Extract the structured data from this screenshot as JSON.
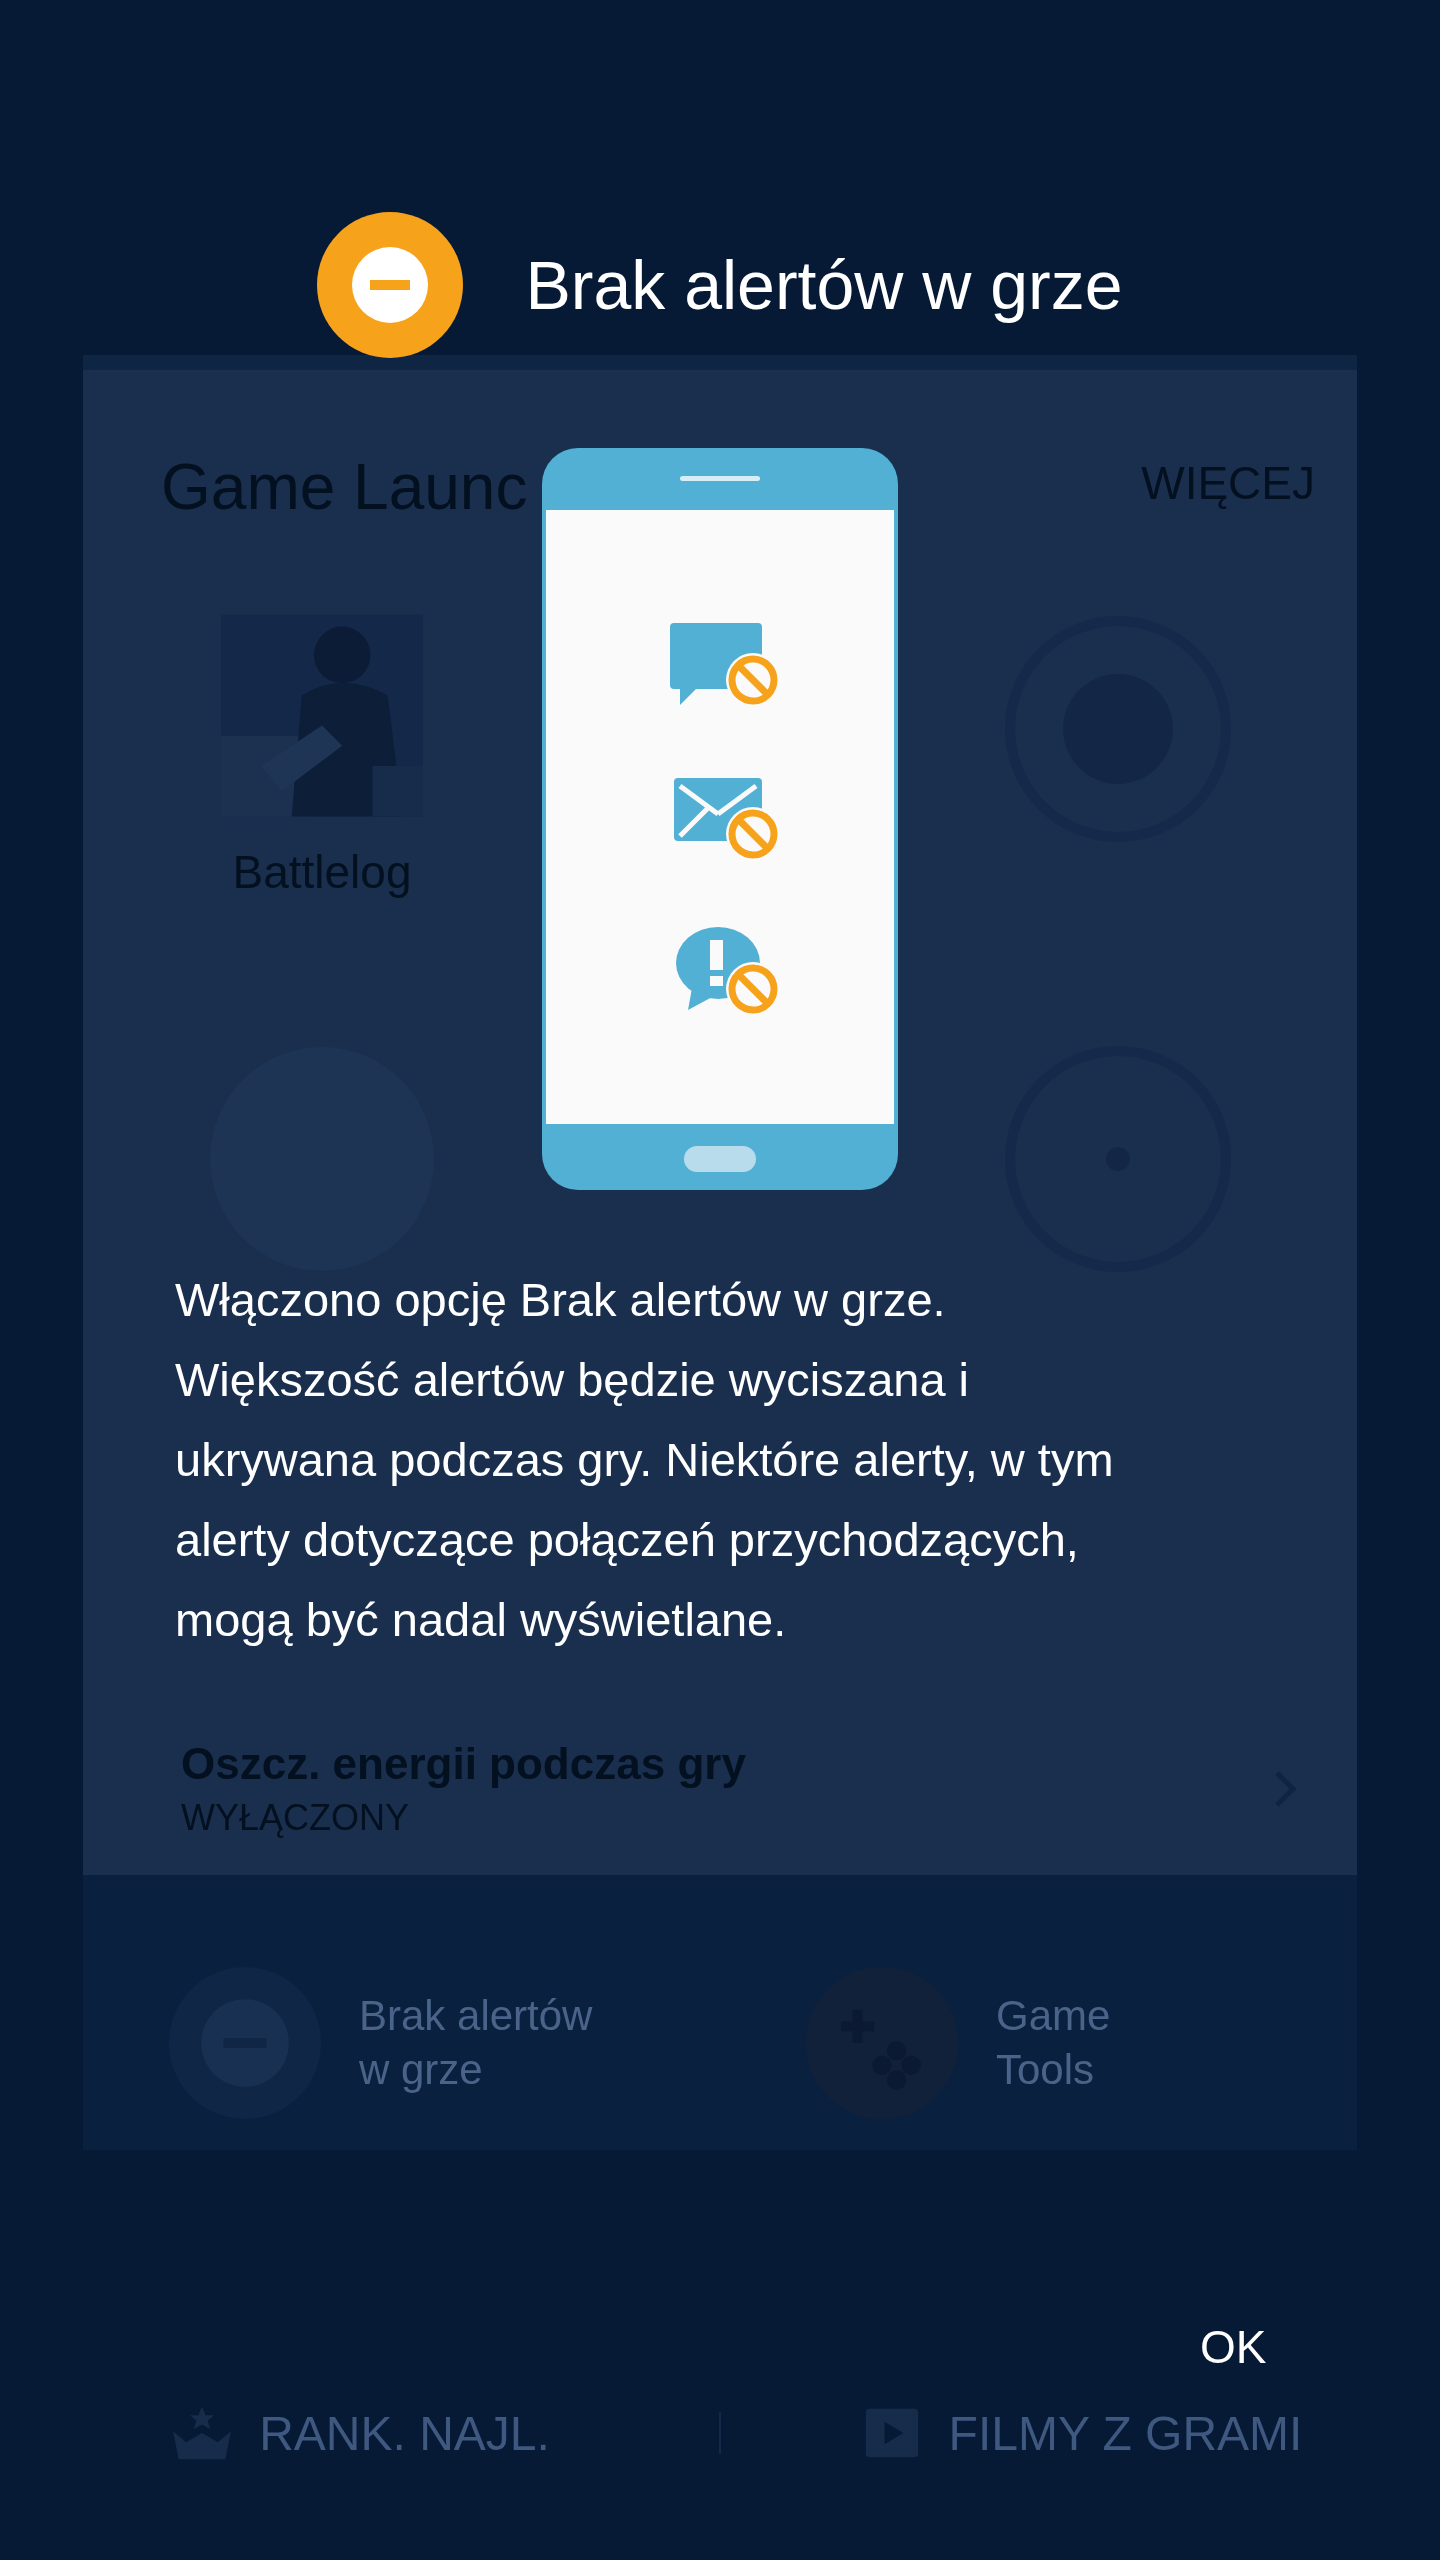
{
  "background_screen": {
    "title": "Game Launc",
    "more_button": "WIĘCEJ",
    "game": {
      "name": "Battlelog",
      "kind": "picture"
    },
    "setting": {
      "title": "Oszcz. energii podczas gry",
      "value": "WYŁĄCZONY"
    },
    "quick_actions": [
      {
        "label": "Brak alertów\nw grze",
        "kind": "no_alerts"
      },
      {
        "label": "Game\nTools",
        "kind": "game_tools"
      }
    ],
    "bottom_nav": [
      {
        "label": "RANK. NAJL.",
        "kind": "ranking"
      },
      {
        "label": "FILMY Z GRAMI",
        "kind": "videos"
      }
    ]
  },
  "dialog": {
    "title": "Brak alertów w grze",
    "message": "Włączono opcję Brak alertów w grze. Większość alertów będzie wyciszana i ukrywana podczas gry. Niektóre alerty, w tym alerty dotyczące połączeń przychodzących, mogą być nadal wyświetlane.",
    "ok_button": "OK"
  }
}
